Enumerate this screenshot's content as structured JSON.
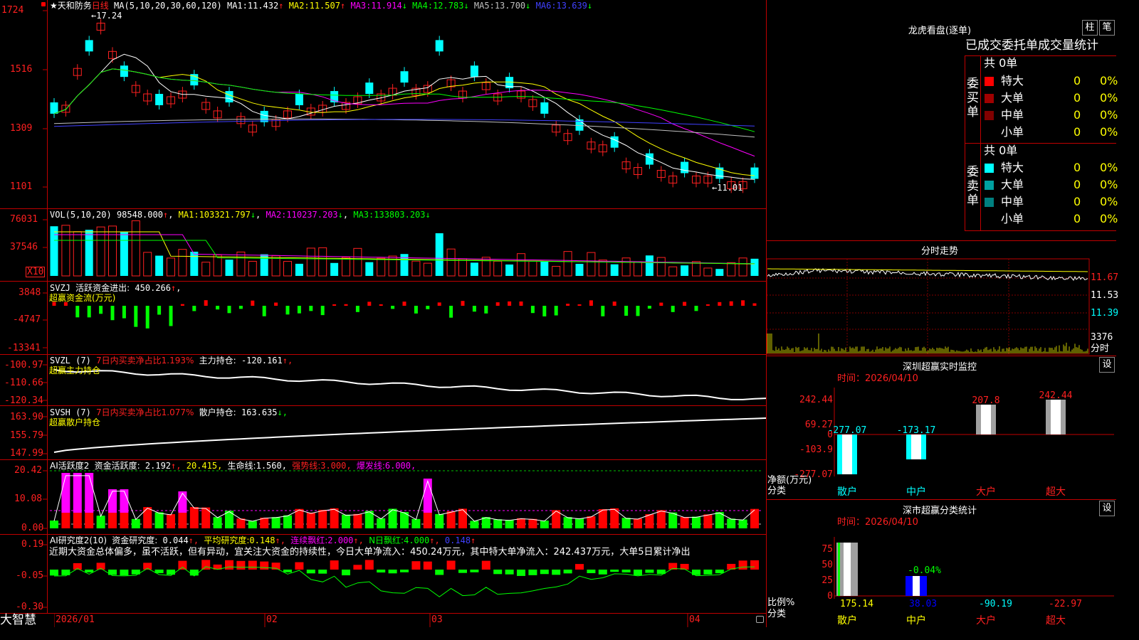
{
  "colors": {
    "bg": "#000000",
    "frame": "#c00000",
    "up": "#ff2020",
    "down": "#00ffff",
    "bar_up": "#ff0000",
    "bar_down": "#00ff00",
    "ma1": "#ffffff",
    "ma2": "#ffff00",
    "ma3": "#ff00ff",
    "ma4": "#00ff00",
    "ma5": "#c0c0c0",
    "ma6": "#4040ff",
    "tag": "#ffff00"
  },
  "top_icon": "red-marker-icon",
  "price_panel": {
    "title": "★天和防务",
    "period": "日线",
    "ma_label": "MA(5,10,20,30,60,120)",
    "ma": [
      {
        "name": "MA1:",
        "value": "11.432",
        "arrow": "↑"
      },
      {
        "name": "MA2:",
        "value": "11.507",
        "arrow": "↑"
      },
      {
        "name": "MA3:",
        "value": "11.914",
        "arrow": "↓"
      },
      {
        "name": "MA4:",
        "value": "12.783",
        "arrow": "↓"
      },
      {
        "name": "MA5:",
        "value": "13.700",
        "arrow": "↓"
      },
      {
        "name": "MA6:",
        "value": "13.639",
        "arrow": "↓"
      }
    ],
    "y_ticks": [
      "1724",
      "1516",
      "1309",
      "1101"
    ],
    "high_label": "17.24",
    "low_label": "11.01"
  },
  "vol_panel": {
    "label": "VOL(5,10,20)",
    "value": "98548.000",
    "value_arrow": "↑",
    "ma": [
      {
        "name": "MA1:",
        "value": "103321.797",
        "arrow": "↓"
      },
      {
        "name": "MA2:",
        "value": "110237.203",
        "arrow": "↓"
      },
      {
        "name": "MA3:",
        "value": "133803.203",
        "arrow": "↓"
      }
    ],
    "y_ticks": [
      "76031",
      "37546"
    ],
    "unit": "X10"
  },
  "svzj_panel": {
    "label": "SVZJ",
    "desc": "活跃资金进出:",
    "value": "450.266",
    "arrow": "↑",
    "sub": "超赢资金流(万元)",
    "y_ticks": [
      "3848",
      "-4747",
      "-13341"
    ]
  },
  "svzl_panel": {
    "label": "SVZL (7)",
    "desc": "7日内买卖净占比1.193%",
    "desc2": "主力持仓:",
    "value": "-120.161",
    "arrow": "↑,",
    "sub": "超赢主力持仓",
    "y_ticks": [
      "-100.97",
      "-110.66",
      "-120.34"
    ]
  },
  "svsh_panel": {
    "label": "SVSH (7)",
    "desc": "7日内买卖净占比1.077%",
    "desc2": "散户持仓:",
    "value": "163.635",
    "arrow": "↓,",
    "sub": "超赢散户持仓",
    "y_ticks": [
      "163.90",
      "155.79",
      "147.99"
    ]
  },
  "ai_active_panel": {
    "label": "AI活跃度2",
    "desc": "资金活跃度:",
    "value": "2.192",
    "arrow": "↑,",
    "v2": "20.415",
    "v2_arrow": ",",
    "life": "生命线:",
    "life_v": "1.560,",
    "strong": "强势线:",
    "strong_v": "3.000,",
    "burst": "爆发线:",
    "burst_v": "6.000,",
    "y_ticks": [
      "20.42",
      "10.08",
      "0.00"
    ]
  },
  "ai_research_panel": {
    "label": "AI研究度2(10)",
    "desc": "资金研究度:",
    "value": "0.044",
    "arrow": "↑,",
    "avg": "平均研究度:",
    "avg_v": "0.148",
    "avg_arrow": "↑,",
    "cont": "连续飘红:",
    "cont_v": "2.000",
    "cont_arrow": "↑,",
    "n": "N日飘红:",
    "n_v": "4.000",
    "n_arrow": "↑,",
    "last": "0.148",
    "last_arrow": "↑",
    "summary": "近期大资金总体偏多，虽不活跃，但有异动，宜关注大资金的持续性，今日大单净流入：450.24万元，其中特大单净流入：242.437万元，大单5日累计净出",
    "y_ticks": [
      "0.19",
      "-0.05",
      "-0.30"
    ]
  },
  "x_axis": {
    "brand": "大智慧",
    "labels": [
      "2026/01",
      "02",
      "03",
      "04"
    ]
  },
  "longhu": {
    "title": "龙虎看盘(逐单)",
    "btn1": "柱",
    "btn2": "笔",
    "header": "已成交委托单成交量统计",
    "buy_side": "委买单",
    "sell_side": "委卖单",
    "buy_total": "共 0单",
    "sell_total": "共 0单",
    "buy_rows": [
      {
        "label": "特大",
        "count": "0",
        "pct": "0%",
        "color": "#ff0000"
      },
      {
        "label": "大单",
        "count": "0",
        "pct": "0%",
        "color": "#a00000"
      },
      {
        "label": "中单",
        "count": "0",
        "pct": "0%",
        "color": "#800000"
      },
      {
        "label": "小单",
        "count": "0",
        "pct": "0%",
        "color": ""
      }
    ],
    "sell_rows": [
      {
        "label": "特大",
        "count": "0",
        "pct": "0%",
        "color": "#00ffff"
      },
      {
        "label": "大单",
        "count": "0",
        "pct": "0%",
        "color": "#00a0a0"
      },
      {
        "label": "中单",
        "count": "0",
        "pct": "0%",
        "color": "#008080"
      },
      {
        "label": "小单",
        "count": "0",
        "pct": "0%",
        "color": ""
      }
    ]
  },
  "intraday": {
    "title": "分时走势",
    "y_ticks": [
      "11.67",
      "11.53",
      "11.39"
    ],
    "vol_tick": "3376",
    "unit": "分时"
  },
  "sz_monitor": {
    "title": "深圳超赢实时监控",
    "btn": "设",
    "date_label": "时间：2026/04/10",
    "y_ticks": [
      "242.44",
      "69.27",
      "0",
      "-103.9",
      "-277.07"
    ],
    "y_label": "净额(万元)",
    "x_label": "分类",
    "categories": [
      "散户",
      "中户",
      "大户",
      "超大"
    ],
    "values": [
      -277.07,
      -173.17,
      207.8,
      242.44
    ],
    "value_labels": [
      "-277.07",
      "-173.17",
      "207.8",
      "242.44"
    ]
  },
  "sz_class": {
    "title": "深市超赢分类统计",
    "btn": "设",
    "date_label": "时间：2026/04/10",
    "y_ticks": [
      "75",
      "50",
      "25",
      "0"
    ],
    "y_label": "比例%",
    "x_label": "分类",
    "categories": [
      "散户",
      "中户",
      "大户",
      "超大"
    ],
    "values": [
      175.14,
      38.03,
      -90.19,
      -22.97
    ],
    "value_labels": [
      "175.14",
      "38.03",
      "-90.19",
      "-22.97"
    ],
    "mid_label": "-0.04%"
  }
}
